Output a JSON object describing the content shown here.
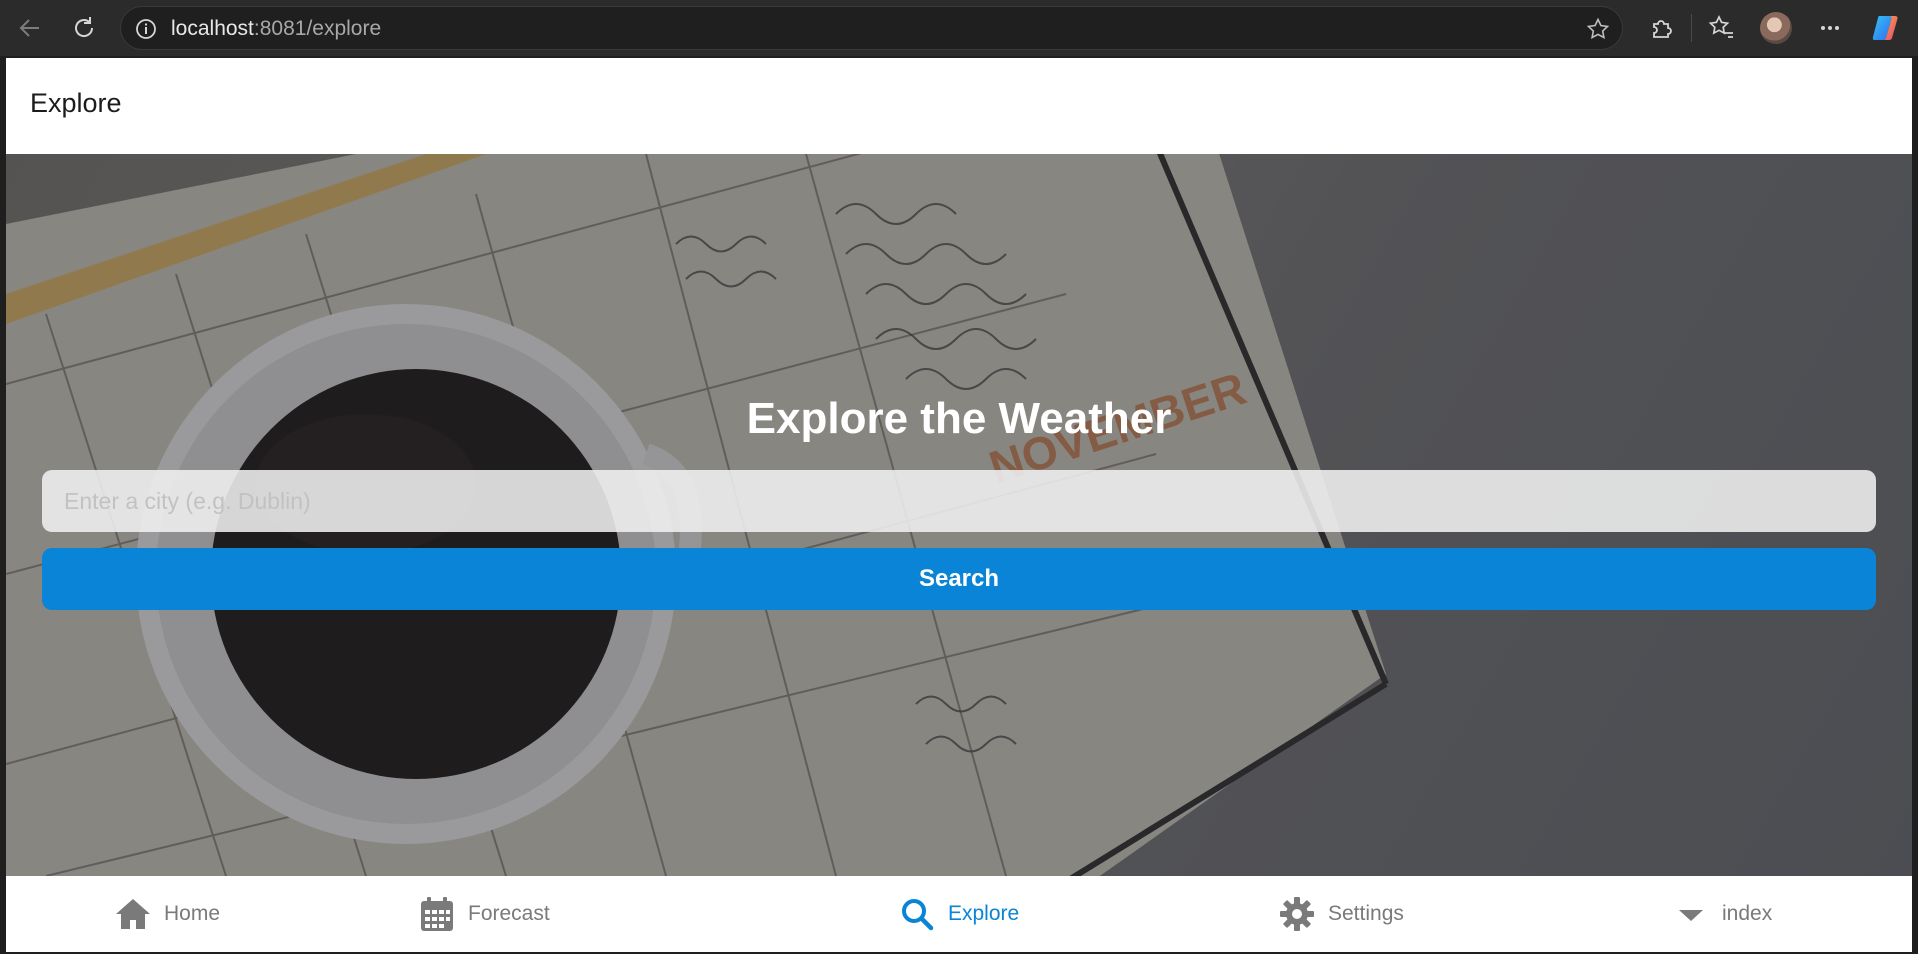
{
  "browser": {
    "url_host": "localhost",
    "url_rest": ":8081/explore",
    "back_icon": "arrow-left-icon",
    "reload_icon": "reload-icon",
    "info_icon": "info-icon",
    "favorite_icon": "star-icon",
    "extensions_icon": "puzzle-icon",
    "favorites_icon": "favorites-icon",
    "more_icon": "ellipsis-icon",
    "copilot_icon": "copilot-icon"
  },
  "header": {
    "title": "Explore"
  },
  "hero": {
    "title": "Explore the Weather",
    "search_placeholder": "Enter a city (e.g. Dublin)",
    "search_value": "",
    "search_button": "Search"
  },
  "tabs": [
    {
      "label": "Home",
      "icon": "home-icon",
      "active": false
    },
    {
      "label": "Forecast",
      "icon": "calendar-icon",
      "active": false
    },
    {
      "label": "Explore",
      "icon": "search-icon",
      "active": true
    },
    {
      "label": "Settings",
      "icon": "gear-icon",
      "active": false
    },
    {
      "label": "index",
      "icon": "caret-down-icon",
      "active": false
    }
  ],
  "colors": {
    "accent": "#0a84d6",
    "tab_inactive": "#7a7a7a",
    "chrome_bg": "#2b2b2b"
  }
}
